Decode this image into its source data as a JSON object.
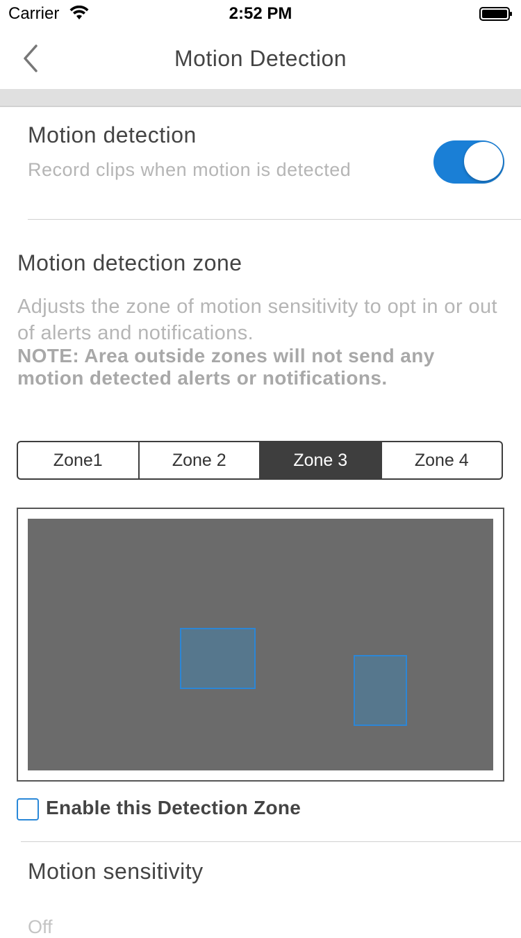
{
  "status_bar": {
    "carrier": "Carrier",
    "time": "2:52 PM"
  },
  "nav": {
    "title": "Motion Detection",
    "back_icon": "chevron-left-icon"
  },
  "motion_detection": {
    "title": "Motion detection",
    "description": "Record clips when motion is detected",
    "enabled": true,
    "toggle_color": "#1a7fd6"
  },
  "zone_section": {
    "title": "Motion detection zone",
    "description": "Adjusts the zone of motion sensitivity to opt in or out of alerts and notifications.",
    "note": "NOTE: Area outside zones will not send any motion detected alerts or notifications."
  },
  "zones": {
    "tabs": [
      {
        "label": "Zone1"
      },
      {
        "label": "Zone 2"
      },
      {
        "label": "Zone 3"
      },
      {
        "label": "Zone 4"
      }
    ],
    "selected": "Zone 3"
  },
  "preview": {
    "zone_color": "#2c86d6"
  },
  "enable_zone": {
    "label": "Enable this Detection Zone",
    "checked": false
  },
  "sensitivity": {
    "title": "Motion sensitivity",
    "value": "Off"
  }
}
